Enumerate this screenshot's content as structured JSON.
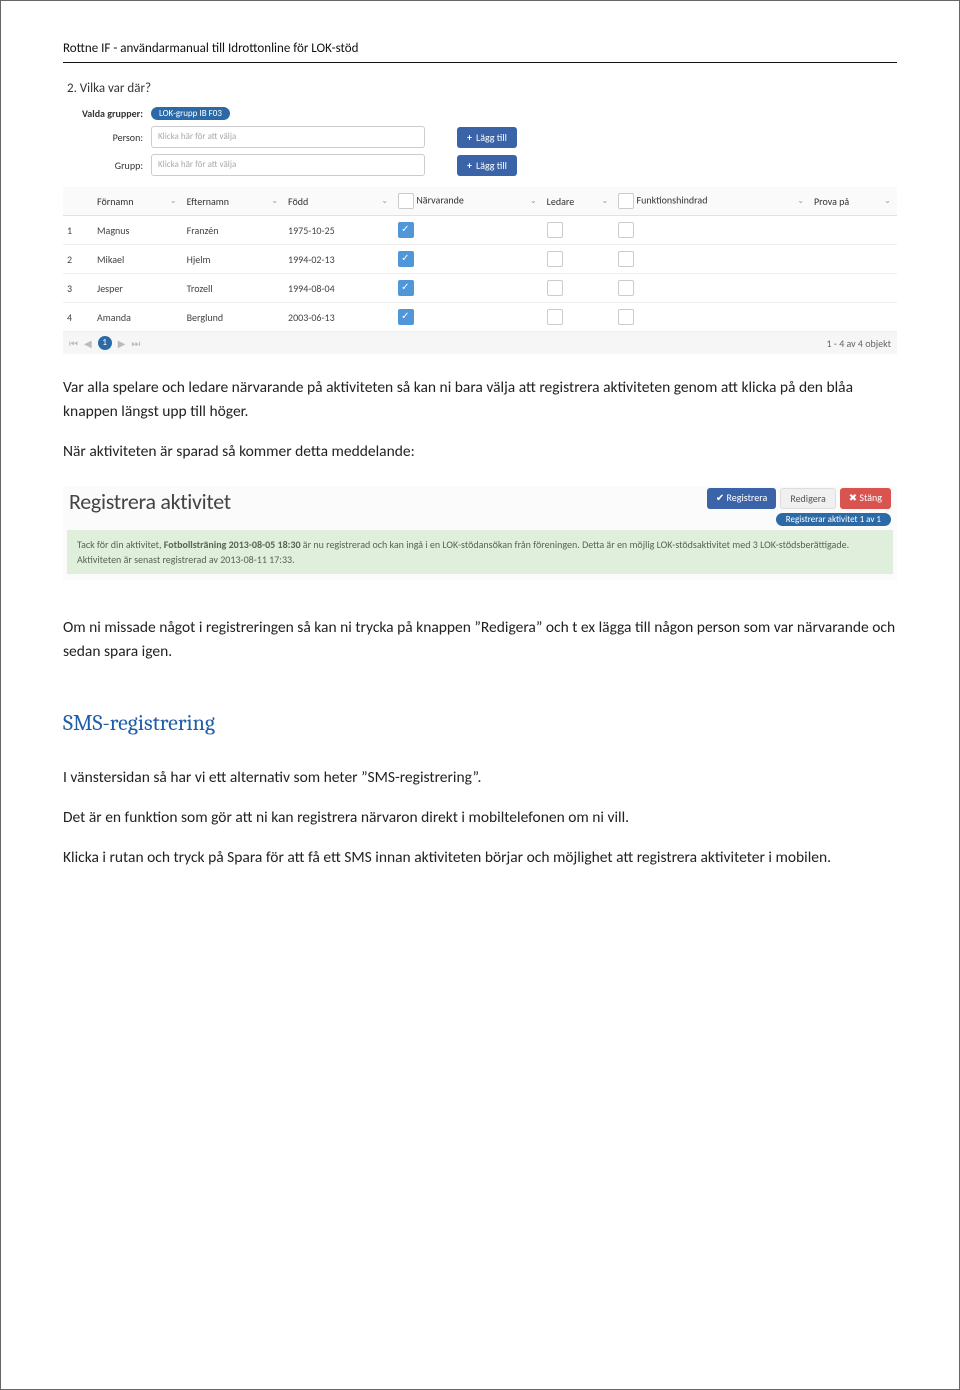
{
  "page_header": "Rottne IF -  användarmanual till Idrottonline för LOK-stöd",
  "scr1": {
    "section_title": "2. Vilka var där?",
    "valda_label": "Valda grupper:",
    "valda_chip": "LOK-grupp IB F03",
    "person_label": "Person:",
    "person_placeholder": "Klicka här för att välja",
    "grupp_label": "Grupp:",
    "grupp_placeholder": "Klicka här för att välja",
    "btn_add": "Lägg till",
    "columns": {
      "num": "",
      "fornamn": "Förnamn",
      "efternamn": "Efternamn",
      "fodd": "Född",
      "narvarande": "Närvarande",
      "ledare": "Ledare",
      "funk": "Funktionshindrad",
      "prova": "Prova på"
    },
    "rows": [
      {
        "n": "1",
        "fn": "Magnus",
        "en": "Franzén",
        "d": "1975-10-25",
        "narv": true
      },
      {
        "n": "2",
        "fn": "Mikael",
        "en": "Hjelm",
        "d": "1994-02-13",
        "narv": true
      },
      {
        "n": "3",
        "fn": "Jesper",
        "en": "Trozell",
        "d": "1994-08-04",
        "narv": true
      },
      {
        "n": "4",
        "fn": "Amanda",
        "en": "Berglund",
        "d": "2003-06-13",
        "narv": true
      }
    ],
    "pager_page": "1",
    "pager_info": "1 - 4 av 4 objekt"
  },
  "para1": "Var alla spelare och ledare närvarande på aktiviteten så kan ni bara välja att registrera aktiviteten genom att klicka på den blåa knappen längst upp till höger.",
  "para2": "När aktiviteten är sparad så kommer detta meddelande:",
  "scr2": {
    "title": "Registrera aktivitet",
    "btn_reg": "✔ Registrera",
    "btn_edit": "Redigera",
    "btn_close": "✖ Stäng",
    "pill": "Registrerar aktivitet 1 av 1",
    "msg_l1_a": "Tack för din aktivitet, ",
    "msg_l1_b": "Fotbollsträning 2013-08-05 18:30",
    "msg_l1_c": " är nu registrerad och kan ingå i en LOK-stödansökan från föreningen. Detta är en möjlig LOK-stödsaktivitet med 3 LOK-stödsberättigade.",
    "msg_l2": "Aktiviteten är senast registrerad av 2013-08-11 17:33."
  },
  "para3": "Om ni missade något i registreringen så kan ni trycka på knappen ”Redigera” och t ex lägga till någon person som var närvarande och sedan spara igen.",
  "heading_sms": "SMS-registrering",
  "para4": "I vänstersidan så har vi ett alternativ som heter ”SMS-registrering”.",
  "para5": "Det är en funktion som gör att ni kan registrera närvaron direkt i mobiltelefonen om ni vill.",
  "para6": "Klicka i rutan och tryck på Spara för att få ett SMS innan aktiviteten börjar och möjlighet att registrera aktiviteter i mobilen."
}
